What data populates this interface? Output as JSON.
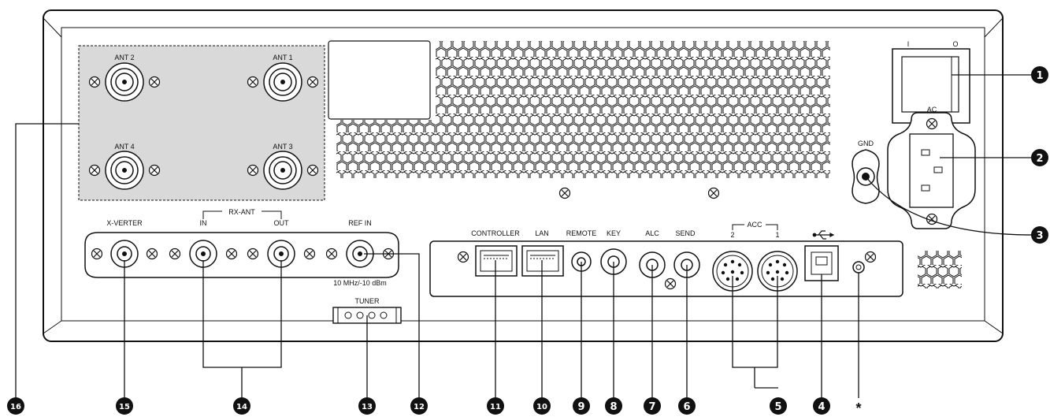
{
  "labels": {
    "ant2": "ANT 2",
    "ant1": "ANT 1",
    "ant4": "ANT 4",
    "ant3": "ANT 3",
    "ac": "AC",
    "gnd": "GND",
    "xverter": "X-VERTER",
    "rx_ant": "RX-ANT",
    "rx_in": "IN",
    "rx_out": "OUT",
    "ref_in": "REF IN",
    "ref_spec": "10 MHz/-10 dBm",
    "tuner": "TUNER",
    "controller": "CONTROLLER",
    "lan": "LAN",
    "remote": "REMOTE",
    "key": "KEY",
    "alc": "ALC",
    "send": "SEND",
    "acc": "ACC",
    "acc2": "2",
    "acc1": "1",
    "switch_on": "I",
    "switch_off": "O"
  },
  "callouts": {
    "c1": "1",
    "c2": "2",
    "c3": "3",
    "c4": "4",
    "c5": "5",
    "c6": "6",
    "c7": "7",
    "c8": "8",
    "c9": "9",
    "c10": "10",
    "c11": "11",
    "c12": "12",
    "c13": "13",
    "c14": "14",
    "c15": "15",
    "c16": "16",
    "asterisk": "*"
  },
  "colors": {
    "panel_fill": "#ffffff",
    "antenna_block": "#d9d9d9",
    "line": "#111111",
    "callout_fill": "#111111",
    "callout_text": "#ffffff"
  }
}
